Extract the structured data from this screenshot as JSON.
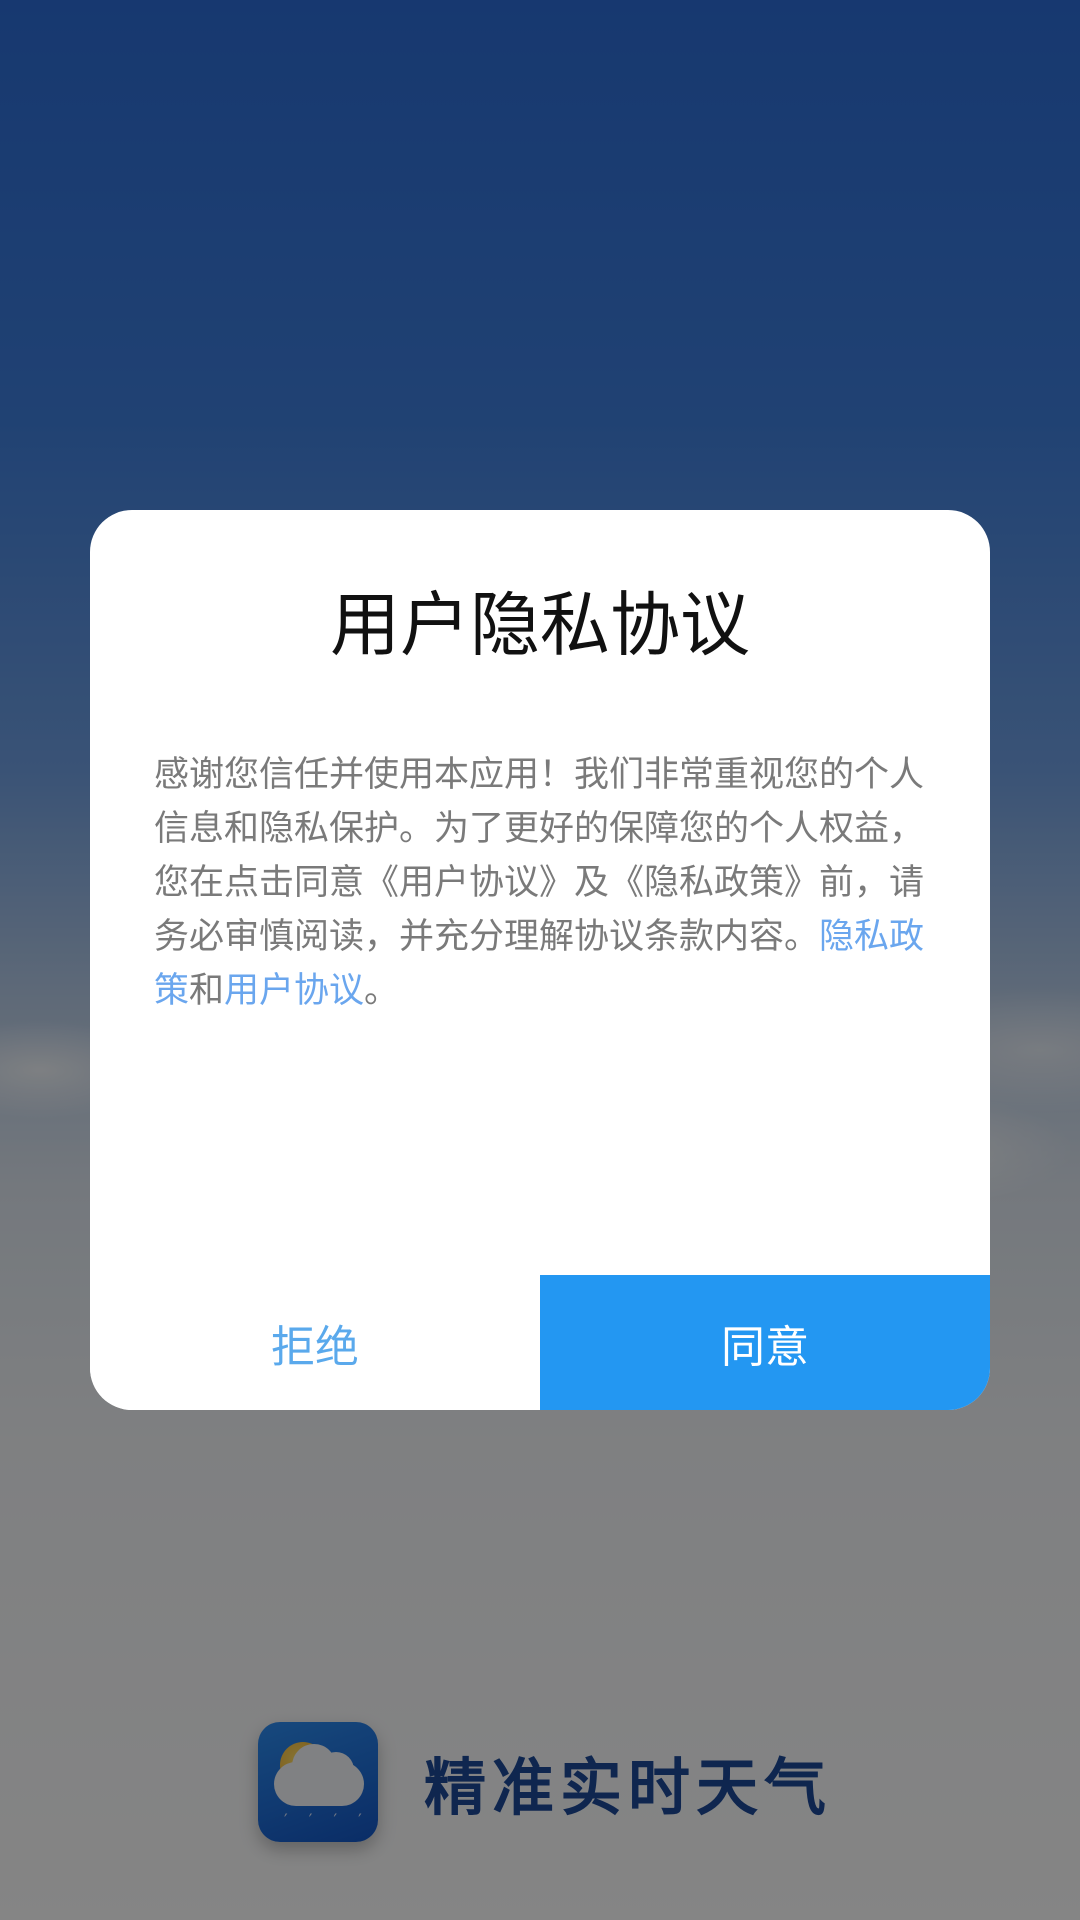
{
  "dialog": {
    "title": "用户隐私协议",
    "body_text": "感谢您信任并使用本应用！我们非常重视您的个人信息和隐私保护。为了更好的保障您的个人权益，您在点击同意《用户协议》及《隐私政策》前，请务必审慎阅读，并充分理解协议条款内容。",
    "privacy_policy_link": "隐私政策",
    "connector": "和",
    "user_agreement_link": "用户协议",
    "end_punct": "。",
    "reject_label": "拒绝",
    "agree_label": "同意"
  },
  "brand": {
    "app_name": "精准实时天气",
    "icon": "weather-cloud-sun-rain-icon"
  },
  "colors": {
    "accent": "#2397f2",
    "link": "#6aa6ee",
    "brand_text": "#1e4a98"
  }
}
